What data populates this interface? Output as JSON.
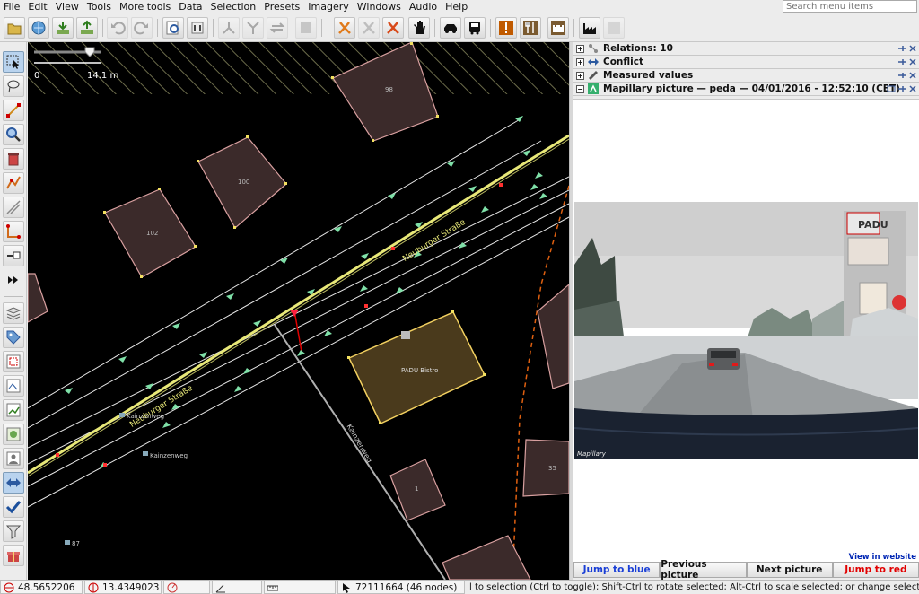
{
  "menu": {
    "items": [
      "File",
      "Edit",
      "View",
      "Tools",
      "More tools",
      "Data",
      "Selection",
      "Presets",
      "Imagery",
      "Windows",
      "Audio",
      "Help"
    ],
    "search_placeholder": "Search menu items"
  },
  "map": {
    "scale_left": "0",
    "scale_right": "14.1 m",
    "buildings": [
      "98",
      "100",
      "102",
      "PADU Bistro",
      "35",
      "1"
    ],
    "street_labels": [
      "Neuburger Straße",
      "Neuburger Straße",
      "Kainzenweg"
    ],
    "poi_labels": [
      "Kainzenweg",
      "Kainzenweg",
      "87"
    ]
  },
  "panels": {
    "relations": "Relations: 10",
    "conflict": "Conflict",
    "measured": "Measured values",
    "mapillary": "Mapillary picture — peda — 04/01/2016 - 12:52:10 (CET)",
    "watermark": "Mapillary",
    "shop_sign": "PADU",
    "view_website": "View in website",
    "buttons": {
      "jump_blue": "Jump to blue",
      "previous": "Previous picture",
      "next": "Next picture",
      "jump_red": "Jump to red"
    }
  },
  "status": {
    "lat": "48.5652206",
    "lon": "13.4349023",
    "way": "72111664 (46 nodes)",
    "help": "l to selection (Ctrl to toggle); Shift-Ctrl to rotate selected; Alt-Ctrl to scale selected; or change selection"
  },
  "colors": {
    "accent_blue": "#1a3fd6",
    "accent_red": "#e10000",
    "building_fill": "#3b2a2a",
    "building_selected": "#4a3a1c",
    "way_yellow": "#e8e878"
  }
}
